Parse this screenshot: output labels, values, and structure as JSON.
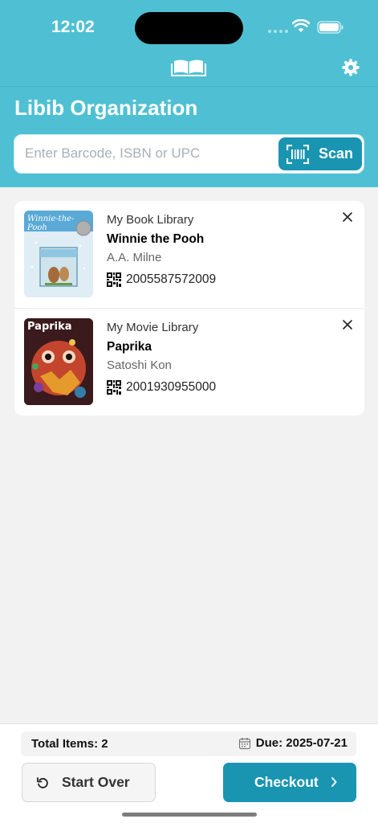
{
  "status": {
    "time": "12:02"
  },
  "header": {
    "org_name": "Libib Organization"
  },
  "search": {
    "placeholder": "Enter Barcode, ISBN or UPC",
    "scan_label": "Scan"
  },
  "items": [
    {
      "library": "My Book Library",
      "title": "Winnie the Pooh",
      "author": "A.A. Milne",
      "code": "2005587572009",
      "cover_text": "Winnie-the-Pooh"
    },
    {
      "library": "My Movie Library",
      "title": "Paprika",
      "author": "Satoshi Kon",
      "code": "2001930955000",
      "cover_text": "Paprika"
    }
  ],
  "footer": {
    "total_label": "Total Items: 2",
    "due_label": "Due: 2025-07-21",
    "start_over_label": "Start Over",
    "checkout_label": "Checkout"
  },
  "colors": {
    "header": "#4fc0d3",
    "accent": "#1995b2",
    "background": "#f2f2f2"
  },
  "icons": [
    "book-icon",
    "gear-icon",
    "barcode-scan-icon",
    "qr-code-icon",
    "close-icon",
    "calendar-icon",
    "undo-icon",
    "chevron-right-icon"
  ]
}
